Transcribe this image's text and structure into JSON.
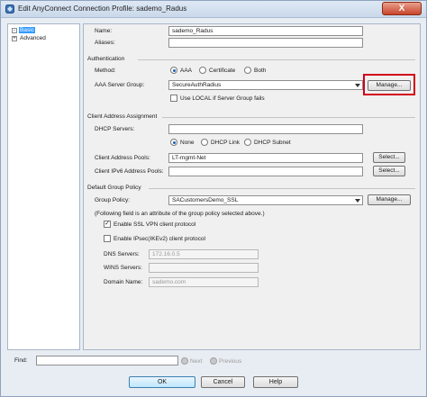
{
  "window": {
    "title": "Edit AnyConnect Connection Profile: sademo_Radus",
    "close_glyph": "X"
  },
  "tree": {
    "items": [
      {
        "label": "Basic",
        "expander": "-"
      },
      {
        "label": "Advanced",
        "expander": "+"
      }
    ]
  },
  "form": {
    "name_label": "Name:",
    "name_value": "sademo_Radus",
    "aliases_label": "Aliases:",
    "aliases_value": "",
    "authentication_section": "Authentication",
    "method_label": "Method:",
    "method_options": [
      "AAA",
      "Certificate",
      "Both"
    ],
    "method_selected": "AAA",
    "aaa_group_label": "AAA Server Group:",
    "aaa_group_value": "SecureAuthRadius",
    "manage_label": "Manage...",
    "use_local_label": "Use LOCAL if Server Group fails",
    "use_local_checked": false,
    "client_addr_section": "Client Address Assignment",
    "dhcp_label": "DHCP Servers:",
    "dhcp_value": "",
    "dhcp_options": [
      "None",
      "DHCP Link",
      "DHCP Subnet"
    ],
    "dhcp_selected": "None",
    "pools_label": "Client Address Pools:",
    "pools_value": "LT-mgmt-Net",
    "select_label": "Select...",
    "ipv6_label": "Client IPv6 Address Pools:",
    "ipv6_value": "",
    "group_policy_section": "Default Group Policy",
    "group_policy_label": "Group Policy:",
    "group_policy_value": "SACustomersDemo_SSL",
    "group_policy_note": "(Following field is an attribute of the group policy selected above.)",
    "ssl_vpn_label": "Enable SSL VPN client protocol",
    "ssl_vpn_checked": true,
    "ipsec_label": "Enable IPsec(IKEv2) client protocol",
    "ipsec_checked": false,
    "dns_label": "DNS Servers:",
    "dns_value": "172.16.0.5",
    "wins_label": "WINS Servers:",
    "wins_value": "",
    "domain_label": "Domain Name:",
    "domain_value": "sademo.com"
  },
  "find_bar": {
    "label": "Find:",
    "value": "",
    "next_label": "Next",
    "previous_label": "Previous"
  },
  "buttons": {
    "ok": "OK",
    "cancel": "Cancel",
    "help": "Help"
  },
  "colors": {
    "highlight": "#d0021b",
    "selection": "#3399ff"
  }
}
